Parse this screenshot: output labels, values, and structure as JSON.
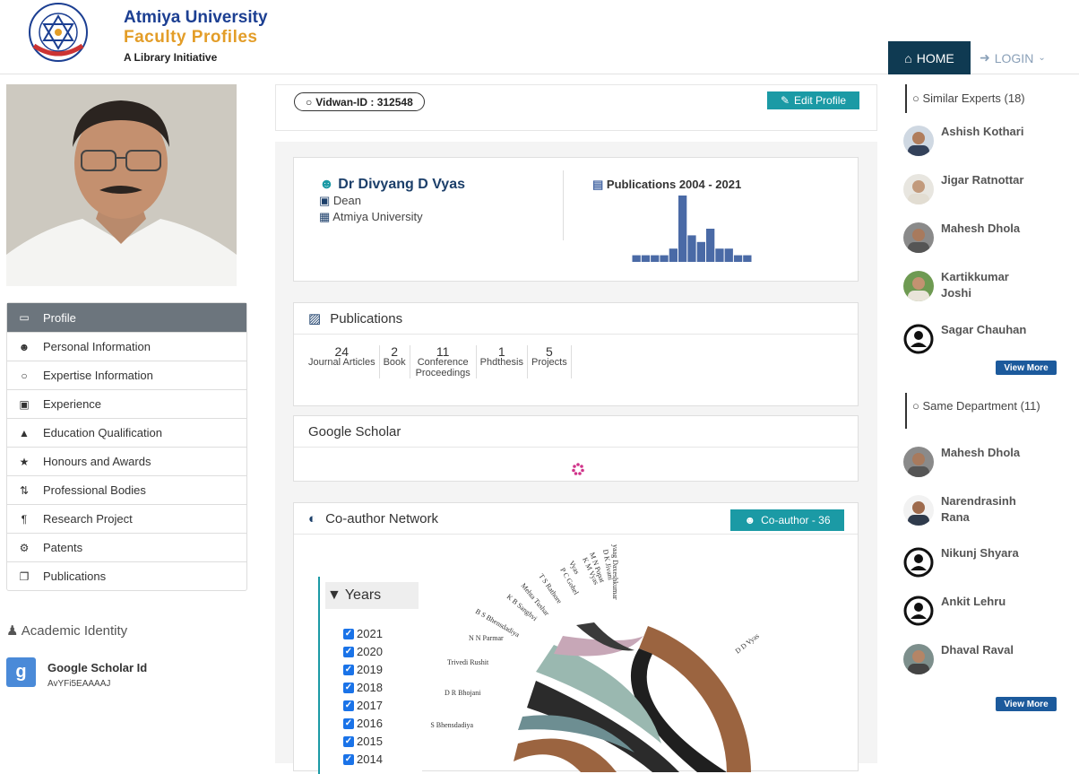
{
  "header": {
    "university": "Atmiya University",
    "subtitle": "Faculty Profiles",
    "tagline": "A Library Initiative",
    "logo_text": "ATMIYA UNIVERSITY"
  },
  "nav": {
    "home": "HOME",
    "login": "LOGIN"
  },
  "menu": {
    "items": [
      {
        "label": "Profile",
        "icon": "monitor-icon"
      },
      {
        "label": "Personal Information",
        "icon": "user-icon"
      },
      {
        "label": "Expertise Information",
        "icon": "lightbulb-icon"
      },
      {
        "label": "Experience",
        "icon": "briefcase-icon"
      },
      {
        "label": "Education Qualification",
        "icon": "graduation-cap-icon"
      },
      {
        "label": "Honours and Awards",
        "icon": "trophy-icon"
      },
      {
        "label": "Professional Bodies",
        "icon": "sort-icon"
      },
      {
        "label": "Research Project",
        "icon": "paragraph-icon"
      },
      {
        "label": "Patents",
        "icon": "cogs-icon"
      },
      {
        "label": "Publications",
        "icon": "copy-icon"
      }
    ]
  },
  "academic": {
    "title": "Academic Identity",
    "scholar_label": "Google Scholar Id",
    "scholar_id": "AvYFi5EAAAAJ"
  },
  "profile": {
    "vidwan": "Vidwan-ID : 312548",
    "edit": "Edit Profile",
    "name": "Dr Divyang D Vyas",
    "designation": "Dean",
    "organization": "Atmiya University",
    "pub_chart_title": "Publications 2004 - 2021"
  },
  "chart_data": {
    "type": "bar",
    "title": "Publications 2004 - 2021",
    "values": [
      1,
      1,
      1,
      1,
      2,
      10,
      4,
      3,
      5,
      2,
      2,
      1,
      1
    ],
    "color": "#4a6aa6"
  },
  "publications": {
    "title": "Publications",
    "stats": [
      {
        "n": "24",
        "l": "Journal Articles"
      },
      {
        "n": "2",
        "l": "Book"
      },
      {
        "n": "11",
        "l": "Conference Proceedings"
      },
      {
        "n": "1",
        "l": "Phdthesis"
      },
      {
        "n": "5",
        "l": "Projects"
      }
    ]
  },
  "scholar": {
    "title": "Google Scholar"
  },
  "coauthor": {
    "title": "Co-author Network",
    "button": "Co-author - 36",
    "years_title": "Years",
    "years": [
      "2021",
      "2020",
      "2019",
      "2018",
      "2017",
      "2016",
      "2015",
      "2014"
    ],
    "names": [
      "D D Vyas",
      "B S Bhensdadiya",
      "D R Bhojani",
      "Trivedi Rushit",
      "N N Parmar",
      "B S Bhensdadiya",
      "K B Sanghvi",
      "Mehta Tushar",
      "T S Rathore",
      "P C Gohel",
      "Vyas",
      "K M Vyas",
      "M N Popat",
      "D K Jivani",
      "yaag Daxeshkumar"
    ]
  },
  "right": {
    "similar_title": "Similar Experts (18)",
    "similar": [
      "Ashish Kothari",
      "Jigar Ratnottar",
      "Mahesh Dhola",
      "Kartikkumar Joshi",
      "Sagar Chauhan"
    ],
    "view_more": "View More",
    "dept_title": "Same Department (11)",
    "dept": [
      "Mahesh Dhola",
      "Narendrasinh Rana",
      "Nikunj Shyara",
      "Ankit Lehru",
      "Dhaval Raval"
    ]
  }
}
